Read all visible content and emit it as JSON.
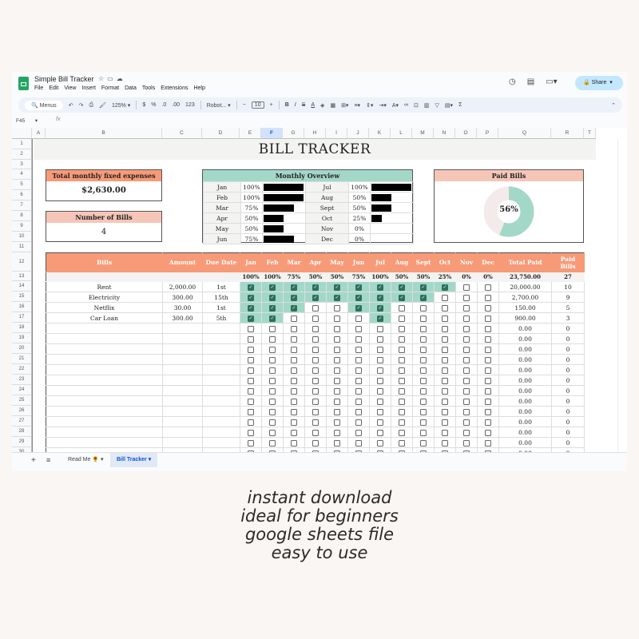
{
  "app": {
    "title": "Simple Bill Tracker",
    "menu": [
      "File",
      "Edit",
      "View",
      "Insert",
      "Format",
      "Data",
      "Tools",
      "Extensions",
      "Help"
    ],
    "share_label": "Share"
  },
  "toolbar": {
    "menus_label": "Menus",
    "zoom": "125%",
    "currency": "$",
    "percent": "%",
    "dec_less": ".0",
    "dec_more": ".00",
    "number_format": "123",
    "font": "Robot...",
    "font_size": "10",
    "bold": "B",
    "italic": "I",
    "sum": "Σ"
  },
  "formula_bar": {
    "cell_ref": "F45",
    "fx": "fx",
    "value": ""
  },
  "columns": [
    "A",
    "B",
    "C",
    "D",
    "E",
    "F",
    "G",
    "H",
    "I",
    "J",
    "K",
    "L",
    "M",
    "N",
    "O",
    "P",
    "Q",
    "R",
    "T"
  ],
  "selected_column": "F",
  "row_numbers": [
    "1",
    "2",
    "3",
    "4",
    "5",
    "6",
    "7",
    "8",
    "9",
    "10",
    "11",
    "12",
    "13",
    "14",
    "15",
    "16",
    "17",
    "18",
    "19",
    "20",
    "21",
    "22",
    "23",
    "24",
    "25",
    "26",
    "27",
    "28",
    "29",
    "30"
  ],
  "sheet": {
    "title": "BILL TRACKER",
    "total_box": {
      "label": "Total monthly fixed expenses",
      "value": "$2,630.00"
    },
    "count_box": {
      "label": "Number of Bills",
      "value": "4"
    },
    "overview": {
      "title": "Monthly Overview",
      "months": [
        {
          "m": "Jan",
          "p": "100%",
          "v": 100
        },
        {
          "m": "Feb",
          "p": "100%",
          "v": 100
        },
        {
          "m": "Mar",
          "p": "75%",
          "v": 75
        },
        {
          "m": "Apr",
          "p": "50%",
          "v": 50
        },
        {
          "m": "May",
          "p": "50%",
          "v": 50
        },
        {
          "m": "Jun",
          "p": "75%",
          "v": 75
        },
        {
          "m": "Jul",
          "p": "100%",
          "v": 100
        },
        {
          "m": "Aug",
          "p": "50%",
          "v": 50
        },
        {
          "m": "Sept",
          "p": "50%",
          "v": 50
        },
        {
          "m": "Oct",
          "p": "25%",
          "v": 25
        },
        {
          "m": "Nov",
          "p": "0%",
          "v": 0
        },
        {
          "m": "Dec",
          "p": "0%",
          "v": 0
        }
      ]
    },
    "paid_box": {
      "label": "Paid Bills",
      "percent": "56%",
      "value": 56,
      "colors": {
        "paid": "#a3d8c9",
        "unpaid": "#f3ebea"
      }
    },
    "table": {
      "headers": [
        "Bills",
        "Amount",
        "Due Date",
        "Jan",
        "Feb",
        "Mar",
        "Apr",
        "May",
        "Jun",
        "Jul",
        "Aug",
        "Sept",
        "Oct",
        "Nov",
        "Dec",
        "Total Paid",
        "Paid Bills"
      ],
      "month_percents": [
        "100%",
        "100%",
        "75%",
        "50%",
        "50%",
        "75%",
        "100%",
        "50%",
        "50%",
        "25%",
        "0%",
        "0%"
      ],
      "total_paid": "23,750.00",
      "total_count": "27",
      "rows": [
        {
          "bill": "Rent",
          "amount": "2,000.00",
          "due": "1st",
          "paid": [
            1,
            1,
            1,
            1,
            1,
            1,
            1,
            1,
            1,
            1,
            0,
            0
          ],
          "total": "20,000.00",
          "count": "10"
        },
        {
          "bill": "Electricity",
          "amount": "300.00",
          "due": "15th",
          "paid": [
            1,
            1,
            1,
            1,
            1,
            1,
            1,
            1,
            1,
            0,
            0,
            0
          ],
          "total": "2,700.00",
          "count": "9"
        },
        {
          "bill": "Netflix",
          "amount": "30.00",
          "due": "1st",
          "paid": [
            1,
            1,
            1,
            0,
            0,
            1,
            1,
            0,
            0,
            0,
            0,
            0
          ],
          "total": "150.00",
          "count": "5"
        },
        {
          "bill": "Car Loan",
          "amount": "300.00",
          "due": "5th",
          "paid": [
            1,
            1,
            0,
            0,
            0,
            0,
            1,
            0,
            0,
            0,
            0,
            0
          ],
          "total": "900.00",
          "count": "3"
        }
      ],
      "empty_total": "0.00",
      "empty_count": "0"
    }
  },
  "tabs": [
    {
      "label": "Read Me 🌻",
      "active": false
    },
    {
      "label": "Bill Tracker",
      "active": true
    }
  ],
  "colors": {
    "header_salmon": "#f79a78",
    "header_pink": "#f5c6b8",
    "teal": "#a3d8c9",
    "overview_header": "#a3d8c9",
    "accent_blue": "#0b57d0"
  },
  "caption": [
    "instant download",
    "ideal for beginners",
    "google sheets file",
    "easy to use"
  ]
}
